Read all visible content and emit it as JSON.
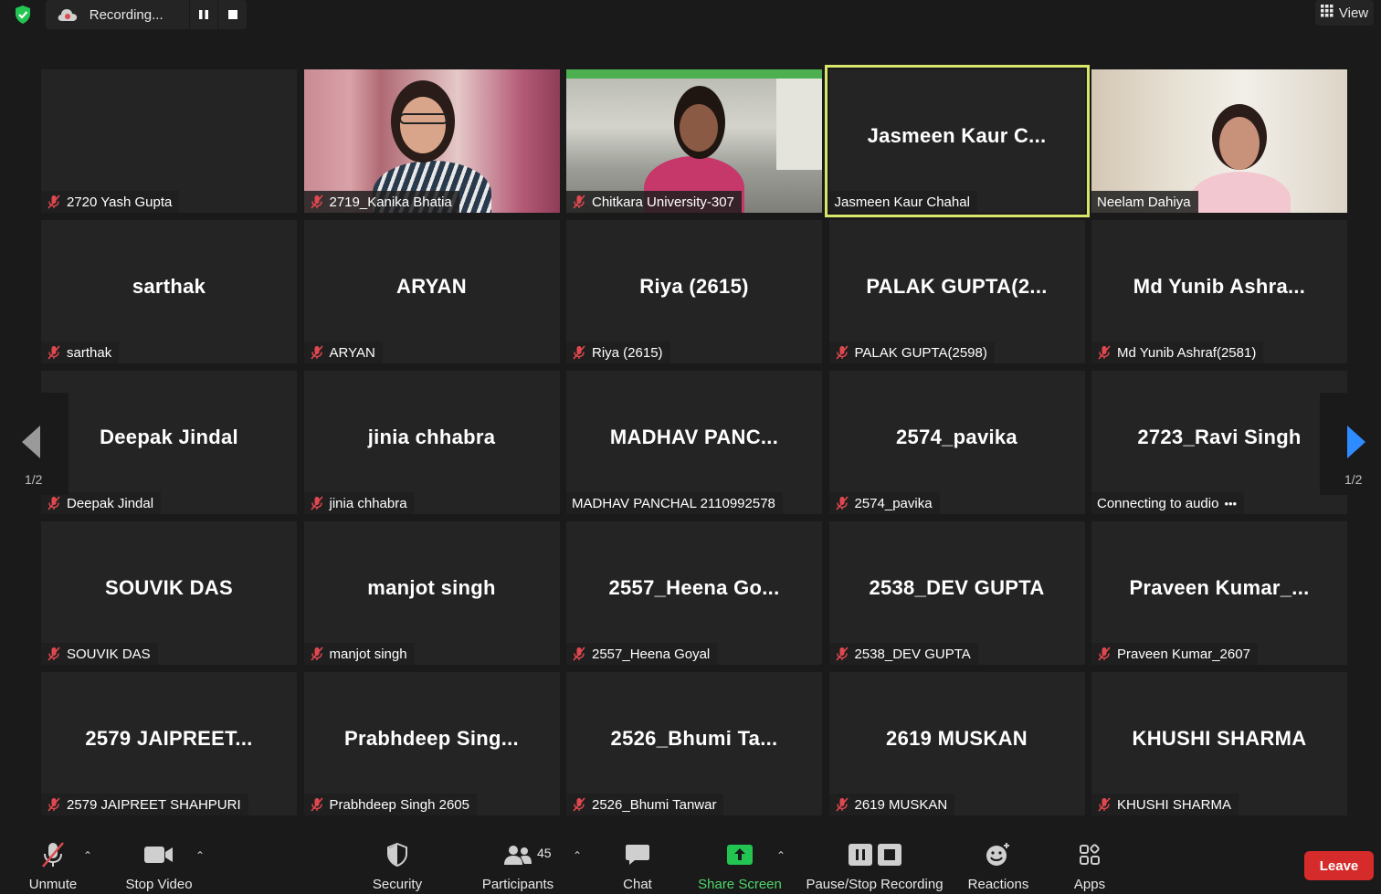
{
  "topbar": {
    "recording_label": "Recording...",
    "view_label": "View"
  },
  "tiles": [
    {
      "big": "",
      "label": "2720 Yash Gupta",
      "muted": true,
      "video": ""
    },
    {
      "big": "",
      "label": "2719_Kanika Bhatia",
      "muted": true,
      "video": "kanika"
    },
    {
      "big": "",
      "label": "Chitkara University-307",
      "muted": true,
      "video": "chit"
    },
    {
      "big": "Jasmeen  Kaur  C...",
      "label": "Jasmeen Kaur Chahal",
      "muted": false,
      "video": "",
      "active": true
    },
    {
      "big": "",
      "label": "Neelam Dahiya",
      "muted": false,
      "video": "neelam"
    },
    {
      "big": "sarthak",
      "label": "sarthak",
      "muted": true
    },
    {
      "big": "ARYAN",
      "label": "ARYAN",
      "muted": true
    },
    {
      "big": "Riya (2615)",
      "label": "Riya (2615)",
      "muted": true
    },
    {
      "big": "PALAK  GUPTA(2...",
      "label": "PALAK GUPTA(2598)",
      "muted": true
    },
    {
      "big": "Md  Yunib  Ashra...",
      "label": "Md Yunib Ashraf(2581)",
      "muted": true
    },
    {
      "big": "Deepak Jindal",
      "label": "Deepak Jindal",
      "muted": true
    },
    {
      "big": "jinia chhabra",
      "label": "jinia chhabra",
      "muted": true
    },
    {
      "big": "MADHAV  PANC...",
      "label": "MADHAV PANCHAL 2110992578",
      "muted": false
    },
    {
      "big": "2574_pavika",
      "label": "2574_pavika",
      "muted": true
    },
    {
      "big": "2723_Ravi Singh",
      "label": "Connecting to audio",
      "muted": false,
      "connecting": true
    },
    {
      "big": "SOUVIK DAS",
      "label": "SOUVIK DAS",
      "muted": true
    },
    {
      "big": "manjot singh",
      "label": "manjot singh",
      "muted": true
    },
    {
      "big": "2557_Heena  Go...",
      "label": "2557_Heena Goyal",
      "muted": true
    },
    {
      "big": "2538_DEV GUPTA",
      "label": "2538_DEV GUPTA",
      "muted": true
    },
    {
      "big": "Praveen  Kumar_...",
      "label": "Praveen Kumar_2607",
      "muted": true
    },
    {
      "big": "2579  JAIPREET...",
      "label": "2579 JAIPREET SHAHPURI",
      "muted": true
    },
    {
      "big": "Prabhdeep  Sing...",
      "label": "Prabhdeep Singh 2605",
      "muted": true
    },
    {
      "big": "2526_Bhumi  Ta...",
      "label": "2526_Bhumi Tanwar",
      "muted": true
    },
    {
      "big": "2619 MUSKAN",
      "label": "2619 MUSKAN",
      "muted": true
    },
    {
      "big": "KHUSHI SHARMA",
      "label": "KHUSHI SHARMA",
      "muted": true
    }
  ],
  "nav": {
    "left_page": "1/2",
    "right_page": "1/2"
  },
  "toolbar": {
    "unmute": "Unmute",
    "stop_video": "Stop Video",
    "security": "Security",
    "participants": "Participants",
    "participants_count": "45",
    "chat": "Chat",
    "share_screen": "Share Screen",
    "pause_stop_recording": "Pause/Stop Recording",
    "reactions": "Reactions",
    "apps": "Apps",
    "leave": "Leave"
  },
  "colors": {
    "active_speaker": "#d8e66a",
    "share_green": "#4fd66b",
    "leave_red": "#d62b2b",
    "mute_red": "#e0484f",
    "nav_blue": "#2d8cff"
  }
}
